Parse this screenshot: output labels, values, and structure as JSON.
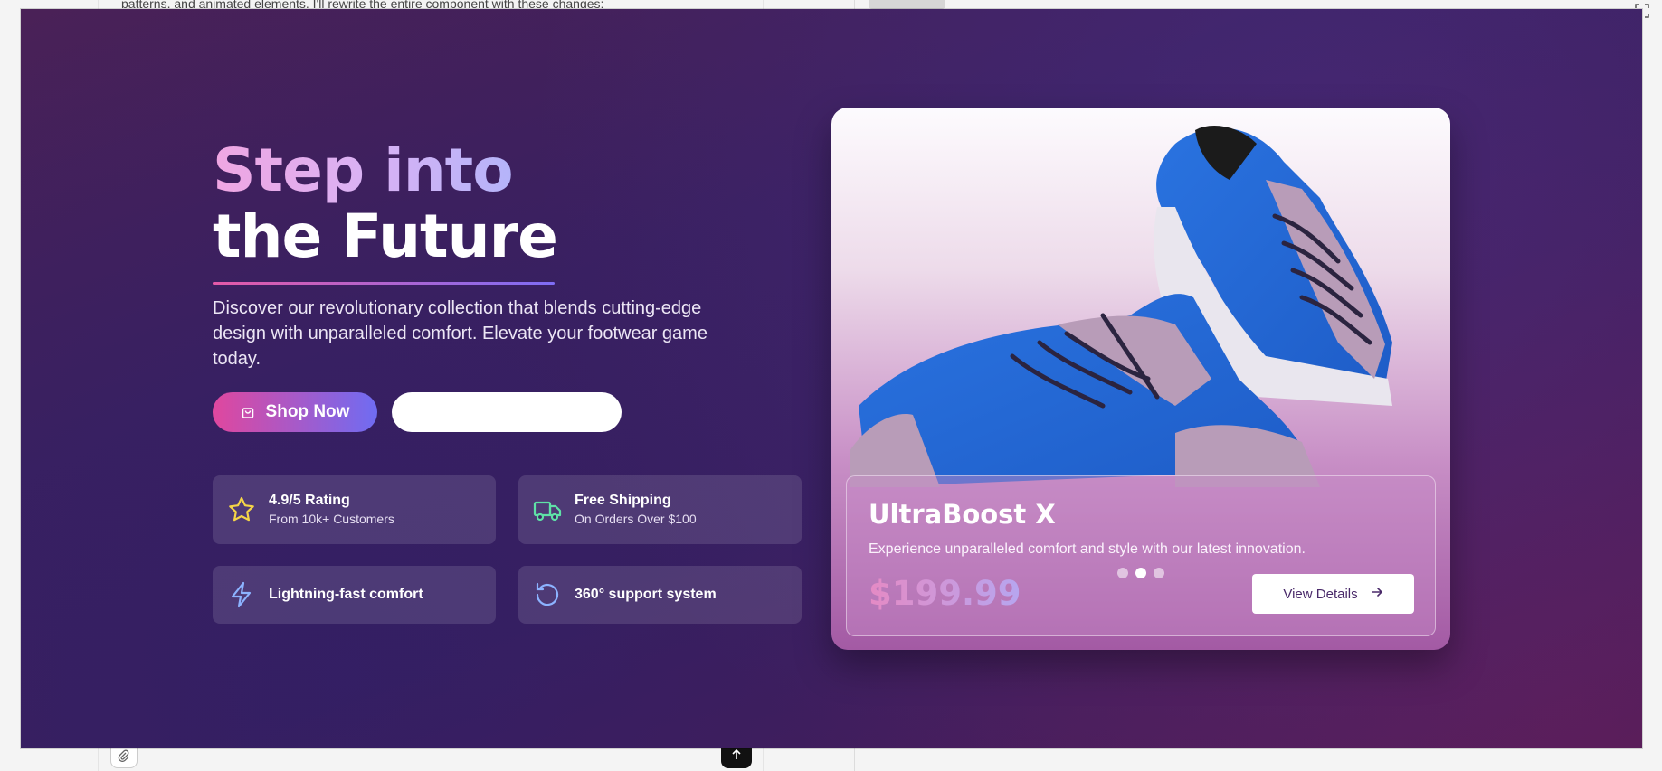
{
  "background": {
    "snippet_text": "patterns, and animated elements. I'll rewrite the entire component with these changes:"
  },
  "hero": {
    "title_line1": "Step into",
    "title_line2": "the Future",
    "description": "Discover our revolutionary collection that blends cutting-edge design with unparalleled comfort. Elevate your footwear game today.",
    "primary_button": "Shop Now",
    "secondary_button": ""
  },
  "features": [
    {
      "icon": "star-icon",
      "title": "4.9/5 Rating",
      "subtitle": "From 10k+ Customers",
      "color": "#f5d547"
    },
    {
      "icon": "truck-icon",
      "title": "Free Shipping",
      "subtitle": "On Orders Over $100",
      "color": "#5fe0a7"
    },
    {
      "icon": "lightning-icon",
      "title": "Lightning-fast comfort",
      "color": "#8cb3ff"
    },
    {
      "icon": "refresh-icon",
      "title": "360° support system",
      "color": "#8cb3ff"
    }
  ],
  "product": {
    "name": "UltraBoost X",
    "description": "Experience unparalleled comfort and style with our latest innovation.",
    "price": "$199.99",
    "details_button": "View Details",
    "carousel_active_index": 1,
    "carousel_count": 3
  },
  "colors": {
    "accent_pink": "#e0479e",
    "accent_purple": "#6f6cf2",
    "background_dark": "#3b205f"
  }
}
